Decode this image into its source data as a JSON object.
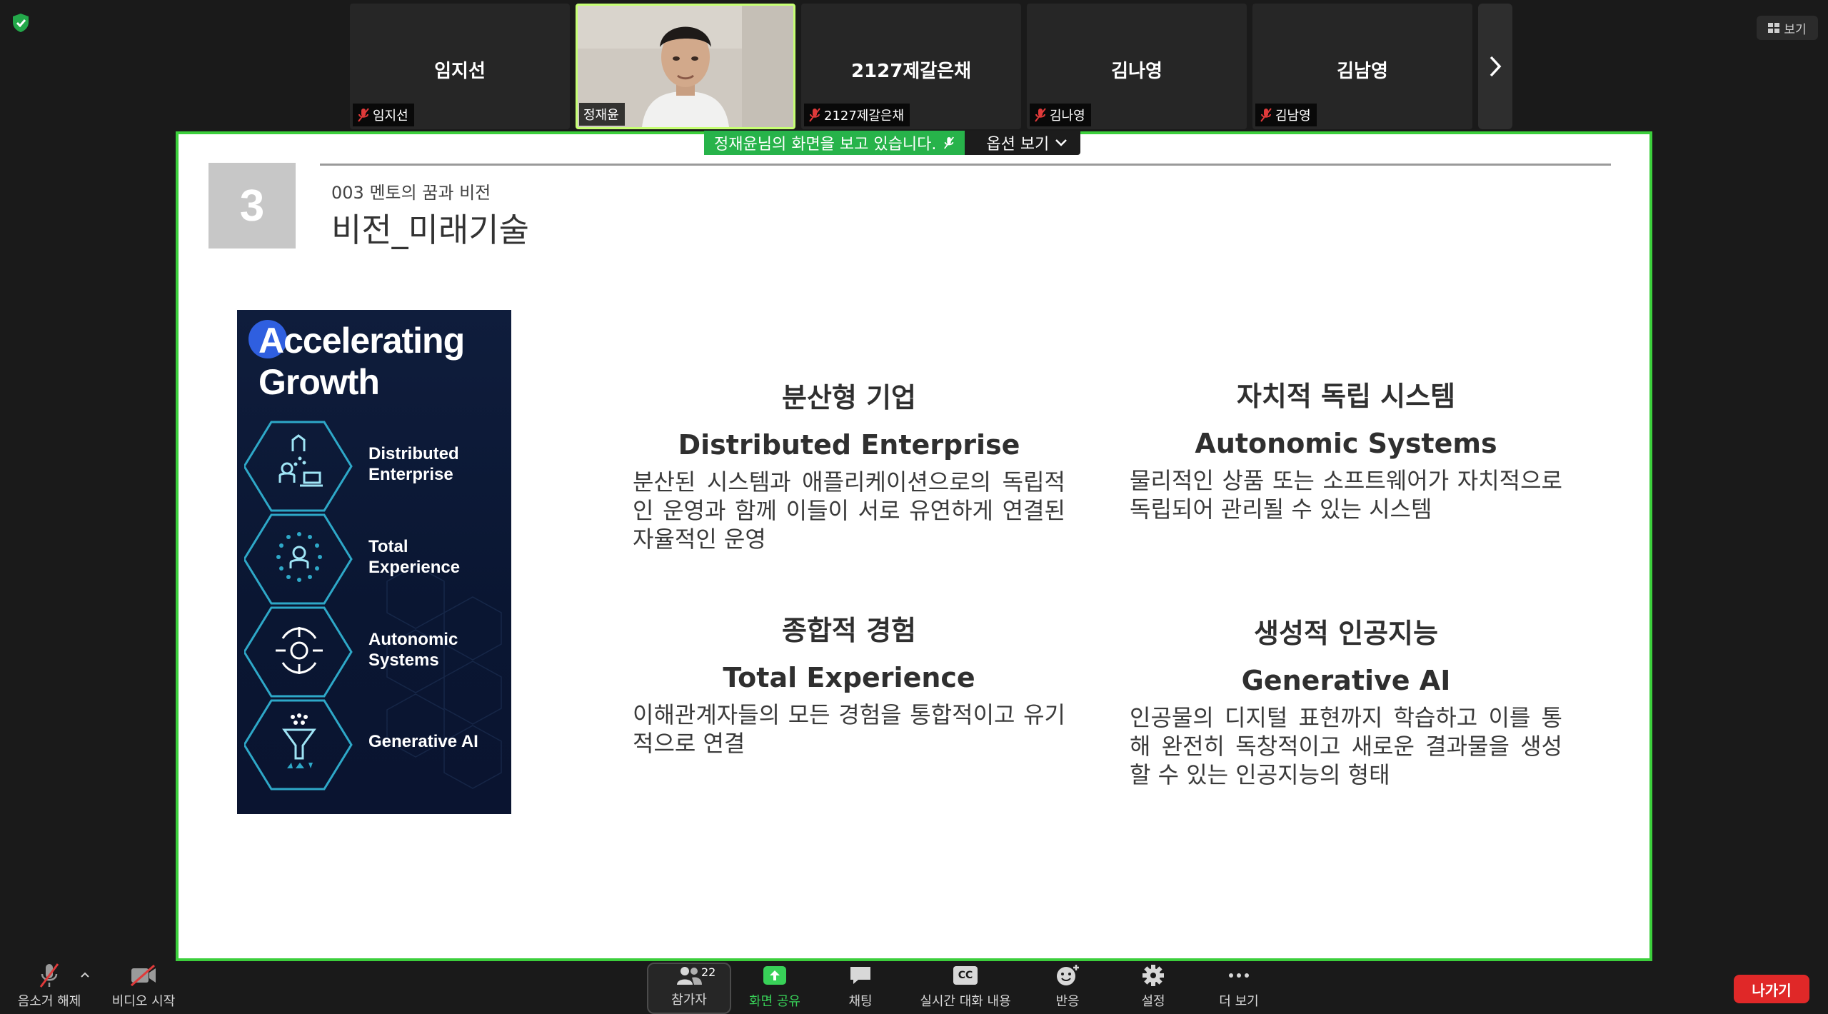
{
  "app": {
    "view_label": "보기",
    "leave_label": "나가기"
  },
  "participants": [
    {
      "name": "임지선",
      "tag": "임지선"
    },
    {
      "name": "",
      "tag": "정재윤",
      "video": true
    },
    {
      "name": "2127제갈은채",
      "tag": "2127제갈은채"
    },
    {
      "name": "김나영",
      "tag": "김나영"
    },
    {
      "name": "김남영",
      "tag": "김남영"
    }
  ],
  "share_banner": {
    "message": "정재윤님의 화면을 보고 있습니다.",
    "options_label": "옵션 보기"
  },
  "slide": {
    "number": "3",
    "subtitle": "003 멘토의 꿈과 비전",
    "title": "비전_미래기술",
    "poster": {
      "headline_line1": "Accelerating",
      "headline_line2": "Growth",
      "items": [
        {
          "label_line1": "Distributed",
          "label_line2": "Enterprise",
          "icon": "building-people-icon"
        },
        {
          "label_line1": "Total",
          "label_line2": "Experience",
          "icon": "person-ring-icon"
        },
        {
          "label_line1": "Autonomic",
          "label_line2": "Systems",
          "icon": "target-gear-icon"
        },
        {
          "label_line1": "Generative AI",
          "label_line2": "",
          "icon": "funnel-icon"
        }
      ]
    },
    "blocks": [
      {
        "ko": "분산형 기업",
        "en": "Distributed Enterprise",
        "desc": "분산된 시스템과 애플리케이션으로의 독립적인 운영과 함께 이들이 서로 유연하게 연결된 자율적인 운영"
      },
      {
        "ko": "자치적 독립 시스템",
        "en": "Autonomic Systems",
        "desc": "물리적인 상품 또는 소프트웨어가 자치적으로 독립되어 관리될 수 있는 시스템"
      },
      {
        "ko": "종합적 경험",
        "en": "Total Experience",
        "desc": " 이해관계자들의 모든 경험을 통합적이고 유기적으로 연결"
      },
      {
        "ko": "생성적 인공지능",
        "en": "Generative AI",
        "desc": "인공물의 디지털 표현까지 학습하고 이를 통해 완전히 독창적이고 새로운 결과물을 생성할 수 있는 인공지능의 형태"
      }
    ]
  },
  "toolbar": {
    "unmute": "음소거 해제",
    "start_video": "비디오 시작",
    "participants": "참가자",
    "participants_count": "22",
    "share_screen": "화면 공유",
    "chat": "채팅",
    "live_transcript": "실시간 대화 내용",
    "reactions": "반응",
    "settings": "설정",
    "more": "더 보기",
    "cc_text": "CC"
  },
  "colors": {
    "share_border": "#3ccf3c",
    "banner_green": "#27b34a",
    "leave_red": "#e02828",
    "poster_navy": "#0f1d3c",
    "hex_cyan": "#2ea8c8"
  }
}
